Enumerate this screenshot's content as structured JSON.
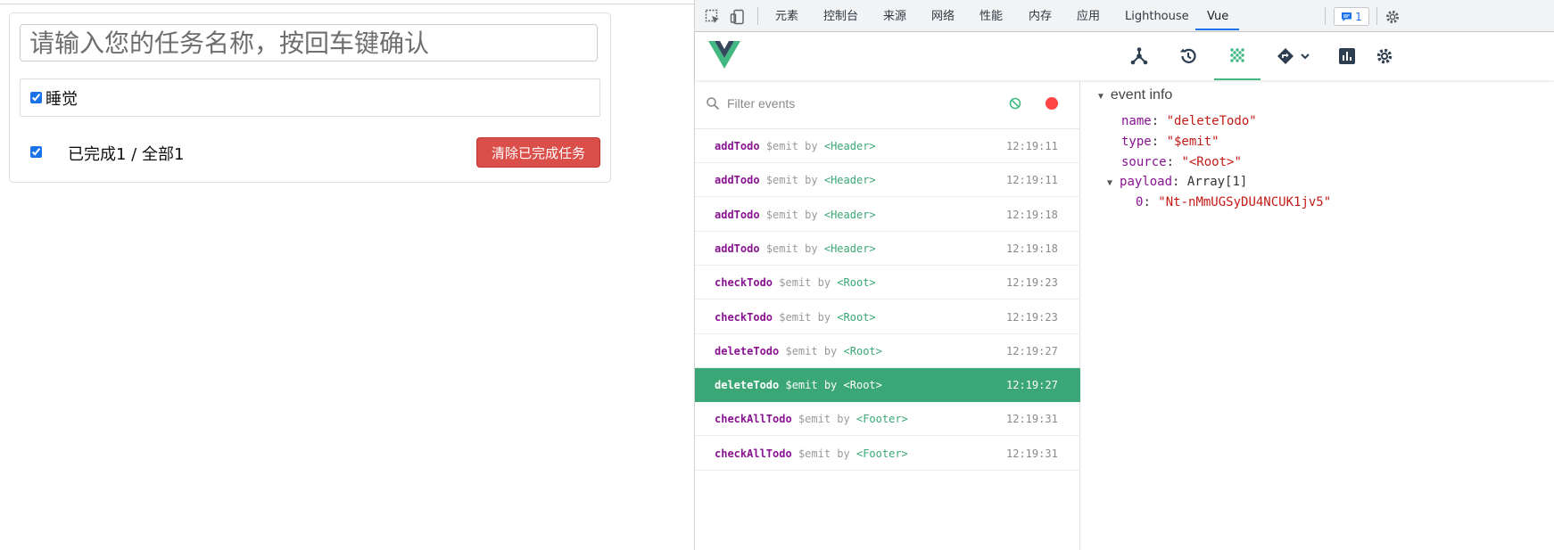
{
  "todo_app": {
    "input_placeholder": "请输入您的任务名称，按回车键确认",
    "todos": [
      {
        "title": "睡觉",
        "done": true
      }
    ],
    "footer": {
      "status_text": "已完成1 / 全部1",
      "check_all": true,
      "clear_button": "清除已完成任务"
    }
  },
  "devtools": {
    "tabs": [
      "元素",
      "控制台",
      "来源",
      "网络",
      "性能",
      "内存",
      "应用",
      "Lighthouse",
      "Vue"
    ],
    "active_tab": "Vue",
    "issues_count": "1",
    "vue_toolbar": {
      "active_tool": "events-timeline"
    },
    "events": {
      "filter_placeholder": "Filter events",
      "list": [
        {
          "name": "addTodo",
          "via": "$emit by",
          "component": "<Header>",
          "time": "12:19:11",
          "selected": false
        },
        {
          "name": "addTodo",
          "via": "$emit by",
          "component": "<Header>",
          "time": "12:19:11",
          "selected": false
        },
        {
          "name": "addTodo",
          "via": "$emit by",
          "component": "<Header>",
          "time": "12:19:18",
          "selected": false
        },
        {
          "name": "addTodo",
          "via": "$emit by",
          "component": "<Header>",
          "time": "12:19:18",
          "selected": false
        },
        {
          "name": "checkTodo",
          "via": "$emit by",
          "component": "<Root>",
          "time": "12:19:23",
          "selected": false
        },
        {
          "name": "checkTodo",
          "via": "$emit by",
          "component": "<Root>",
          "time": "12:19:23",
          "selected": false
        },
        {
          "name": "deleteTodo",
          "via": "$emit by",
          "component": "<Root>",
          "time": "12:19:27",
          "selected": false
        },
        {
          "name": "deleteTodo",
          "via": "$emit by",
          "component": "<Root>",
          "time": "12:19:27",
          "selected": true
        },
        {
          "name": "checkAllTodo",
          "via": "$emit by",
          "component": "<Footer>",
          "time": "12:19:31",
          "selected": false
        },
        {
          "name": "checkAllTodo",
          "via": "$emit by",
          "component": "<Footer>",
          "time": "12:19:31",
          "selected": false
        }
      ]
    },
    "event_info": {
      "header": "event info",
      "name_key": "name",
      "name_value": "\"deleteTodo\"",
      "type_key": "type",
      "type_value": "\"$emit\"",
      "source_key": "source",
      "source_value": "\"<Root>\"",
      "payload_key": "payload",
      "payload_value": "Array[1]",
      "payload_index": "0",
      "payload_item": "\"Nt-nMmUGSyDU4NCUK1jv5\""
    },
    "colors": {
      "vue_green": "#42b883",
      "selected_row": "#3ba776",
      "event_name": "#881391",
      "string_value": "#c41a16",
      "danger_button": "#da4f49"
    }
  }
}
